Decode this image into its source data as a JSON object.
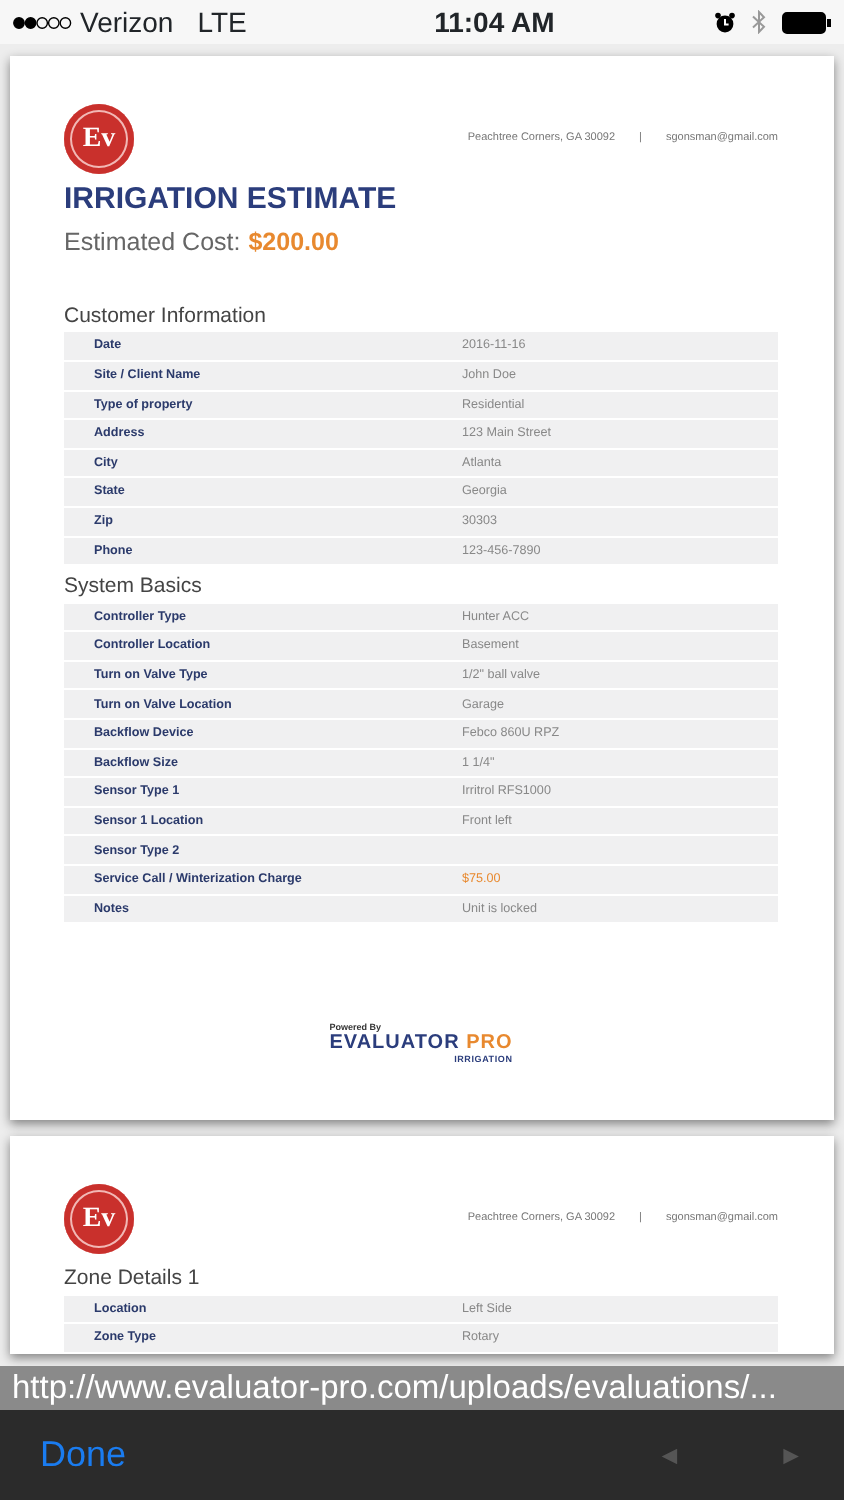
{
  "status_bar": {
    "carrier": "Verizon",
    "network": "LTE",
    "time": "11:04 AM"
  },
  "pages": [
    {
      "address": "Peachtree Corners, GA 30092",
      "separator": "|",
      "email": "sgonsman@gmail.com",
      "logo_text": "Ev",
      "title": "IRRIGATION ESTIMATE",
      "cost_label": "Estimated Cost:",
      "cost_value": "$200.00",
      "sections": [
        {
          "heading": "Customer Information",
          "rows": [
            {
              "label": "Date",
              "value": "2016-11-16",
              "kind": "plain"
            },
            {
              "label": "Site / Client Name",
              "value": "John Doe",
              "kind": "plain"
            },
            {
              "label": "Type of property",
              "value": "Residential",
              "kind": "plain"
            },
            {
              "label": "Address",
              "value": "123 Main Street",
              "kind": "plain"
            },
            {
              "label": "City",
              "value": "Atlanta",
              "kind": "plain"
            },
            {
              "label": "State",
              "value": "Georgia",
              "kind": "plain"
            },
            {
              "label": "Zip",
              "value": "30303",
              "kind": "plain"
            },
            {
              "label": "Phone",
              "value": "123-456-7890",
              "kind": "plain"
            }
          ]
        },
        {
          "heading": "System Basics",
          "rows": [
            {
              "label": "Controller Type",
              "value": "Hunter ACC",
              "kind": "plain"
            },
            {
              "label": "Controller Location",
              "value": "Basement",
              "kind": "plain"
            },
            {
              "label": "Turn on Valve Type",
              "value": "1/2\" ball valve",
              "kind": "plain"
            },
            {
              "label": "Turn on Valve Location",
              "value": "Garage",
              "kind": "plain"
            },
            {
              "label": "Backflow Device",
              "value": "Febco 860U RPZ",
              "kind": "plain"
            },
            {
              "label": "Backflow Size",
              "value": "1 1/4\"",
              "kind": "plain"
            },
            {
              "label": "Sensor Type 1",
              "value": "Irritrol RFS1000",
              "kind": "plain"
            },
            {
              "label": "Sensor 1 Location",
              "value": "Front left",
              "kind": "plain"
            },
            {
              "label": "Sensor Type 2",
              "kind": "plain"
            },
            {
              "label": "Service Call / Winterization Charge",
              "value": "$75.00",
              "kind": "amount"
            },
            {
              "label": "Notes",
              "value": "Unit is locked",
              "kind": "plain"
            }
          ]
        }
      ],
      "footer": {
        "powered_by": "Powered By",
        "brand": "EVALUATOR",
        "brand_accent": "PRO",
        "brand_sub": "IRRIGATION"
      }
    },
    {
      "address": "Peachtree Corners, GA 30092",
      "separator": "|",
      "email": "sgonsman@gmail.com",
      "logo_text": "Ev",
      "sections": [
        {
          "heading": "Zone Details 1",
          "rows": [
            {
              "label": "Location",
              "value": "Left Side",
              "kind": "plain"
            },
            {
              "label": "Zone Type",
              "value": "Rotary",
              "kind": "plain"
            }
          ]
        }
      ]
    }
  ],
  "url": "http://www.evaluator-pro.com/uploads/evaluations/...",
  "toolbar": {
    "done": "Done",
    "back": {
      "glyph": "◄",
      "disabled": true
    },
    "forward": {
      "glyph": "►",
      "disabled": true
    }
  }
}
